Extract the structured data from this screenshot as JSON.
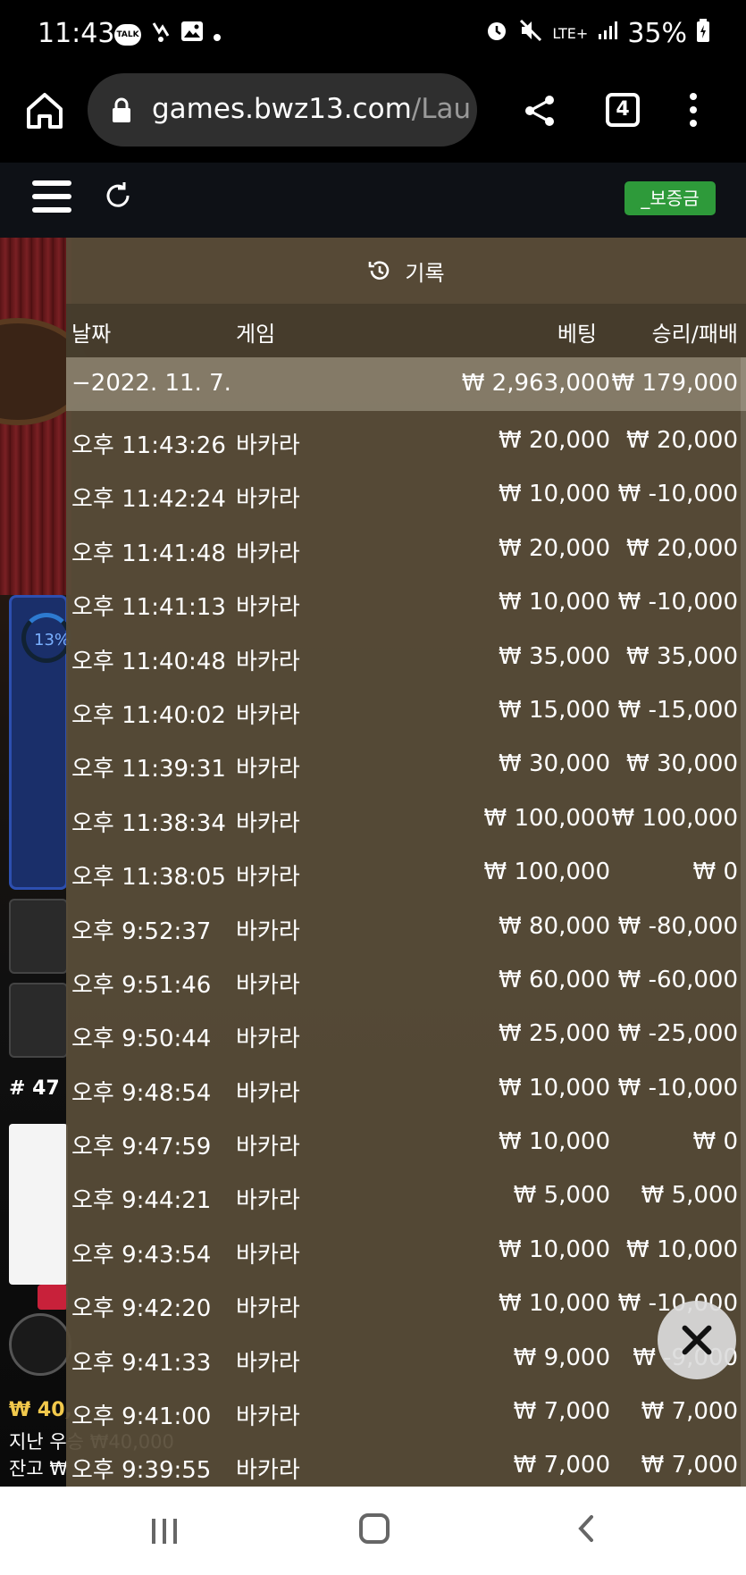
{
  "status_bar": {
    "time": "11:43",
    "talk_label": "TALK",
    "network": "LTE+",
    "battery": "35%"
  },
  "browser": {
    "url_main": "games.bwz13.com",
    "url_rest": "/Lau",
    "tab_count": "4"
  },
  "header": {
    "deposit_label": "_보증금"
  },
  "background": {
    "percent": "13%",
    "round": "# 47",
    "bottom_amount": "₩ 40,",
    "bottom_line2": "지난 우승 ₩40,000",
    "bottom_line3": "잔고 ₩"
  },
  "history": {
    "title": "기록",
    "columns": {
      "date": "날짜",
      "game": "게임",
      "bet": "베팅",
      "winloss": "승리/패배"
    },
    "day": {
      "date": "−2022. 11. 7.",
      "bet": "₩ 2,963,000",
      "winloss": "₩ 179,000"
    },
    "rows": [
      {
        "time": "오후 11:43:26",
        "game": "바카라",
        "bet": "₩ 20,000",
        "winloss": "₩ 20,000"
      },
      {
        "time": "오후 11:42:24",
        "game": "바카라",
        "bet": "₩ 10,000",
        "winloss": "₩ -10,000"
      },
      {
        "time": "오후 11:41:48",
        "game": "바카라",
        "bet": "₩ 20,000",
        "winloss": "₩ 20,000"
      },
      {
        "time": "오후 11:41:13",
        "game": "바카라",
        "bet": "₩ 10,000",
        "winloss": "₩ -10,000"
      },
      {
        "time": "오후 11:40:48",
        "game": "바카라",
        "bet": "₩ 35,000",
        "winloss": "₩ 35,000"
      },
      {
        "time": "오후 11:40:02",
        "game": "바카라",
        "bet": "₩ 15,000",
        "winloss": "₩ -15,000"
      },
      {
        "time": "오후 11:39:31",
        "game": "바카라",
        "bet": "₩ 30,000",
        "winloss": "₩ 30,000"
      },
      {
        "time": "오후 11:38:34",
        "game": "바카라",
        "bet": "₩ 100,000",
        "winloss": "₩ 100,000"
      },
      {
        "time": "오후 11:38:05",
        "game": "바카라",
        "bet": "₩ 100,000",
        "winloss": "₩ 0"
      },
      {
        "time": "오후 9:52:37",
        "game": "바카라",
        "bet": "₩ 80,000",
        "winloss": "₩ -80,000"
      },
      {
        "time": "오후 9:51:46",
        "game": "바카라",
        "bet": "₩ 60,000",
        "winloss": "₩ -60,000"
      },
      {
        "time": "오후 9:50:44",
        "game": "바카라",
        "bet": "₩ 25,000",
        "winloss": "₩ -25,000"
      },
      {
        "time": "오후 9:48:54",
        "game": "바카라",
        "bet": "₩ 10,000",
        "winloss": "₩ -10,000"
      },
      {
        "time": "오후 9:47:59",
        "game": "바카라",
        "bet": "₩ 10,000",
        "winloss": "₩ 0"
      },
      {
        "time": "오후 9:44:21",
        "game": "바카라",
        "bet": "₩ 5,000",
        "winloss": "₩ 5,000"
      },
      {
        "time": "오후 9:43:54",
        "game": "바카라",
        "bet": "₩ 10,000",
        "winloss": "₩ 10,000"
      },
      {
        "time": "오후 9:42:20",
        "game": "바카라",
        "bet": "₩ 10,000",
        "winloss": "₩ -10,000"
      },
      {
        "time": "오후 9:41:33",
        "game": "바카라",
        "bet": "₩ 9,000",
        "winloss": "₩ -9,000"
      },
      {
        "time": "오후 9:41:00",
        "game": "바카라",
        "bet": "₩ 7,000",
        "winloss": "₩ 7,000"
      },
      {
        "time": "오후 9:39:55",
        "game": "바카라",
        "bet": "₩ 7,000",
        "winloss": "₩ 7,000"
      }
    ]
  }
}
